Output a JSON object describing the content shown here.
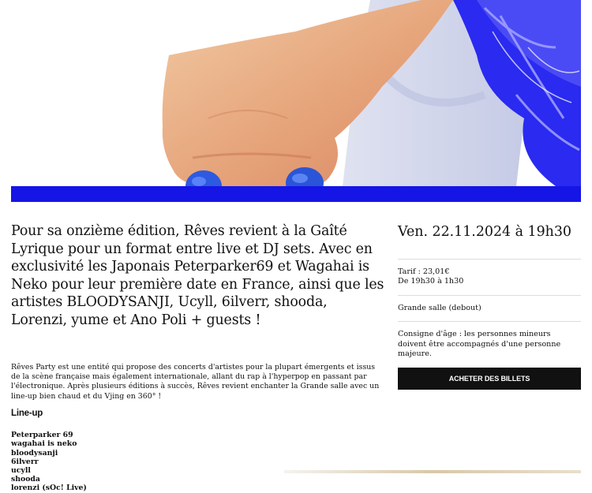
{
  "hero": {
    "image_icon": "hero-photo-hand-blue-nails",
    "accent_color": "#1515e6"
  },
  "intro": "Pour sa onzième édition, Rêves revient à la Gaîté Lyrique pour un format entre live et DJ sets. Avec en exclusivité les Japonais Peterparker69 et Wagahai is Neko pour leur première date en France, ainsi que les artistes BLOODYSANJI, Ucyll, 6ilverr, shooda, Lorenzi, yume et Ano Poli + guests !",
  "description": "Rêves Party est une entité qui propose des concerts d'artistes pour la plupart émergents et issus de la scène française mais également internationale, allant du rap à l'hyperpop en passant par l'électronique. Après plusieurs éditions à succès, Rêves revient enchanter la Grande salle avec un line-up bien chaud et du Vjing en 360° !",
  "lineup": {
    "title": "Line-up",
    "items": [
      "Peterparker 69",
      "wagahai is neko",
      "bloodysanji",
      "6ilverr",
      "ucyll",
      "shooda",
      "lorenzi (sOc! Live)"
    ]
  },
  "event": {
    "date": "Ven. 22.11.2024 à 19h30",
    "tarif": "Tarif : 23,01€",
    "hours": "De 19h30 à 1h30",
    "venue": "Grande salle (debout)",
    "age_notice": "Consigne d'âge : les personnes mineurs doivent être accompagnés d'une personne majeure.",
    "buy_label": "ACHETER DES BILLETS"
  }
}
